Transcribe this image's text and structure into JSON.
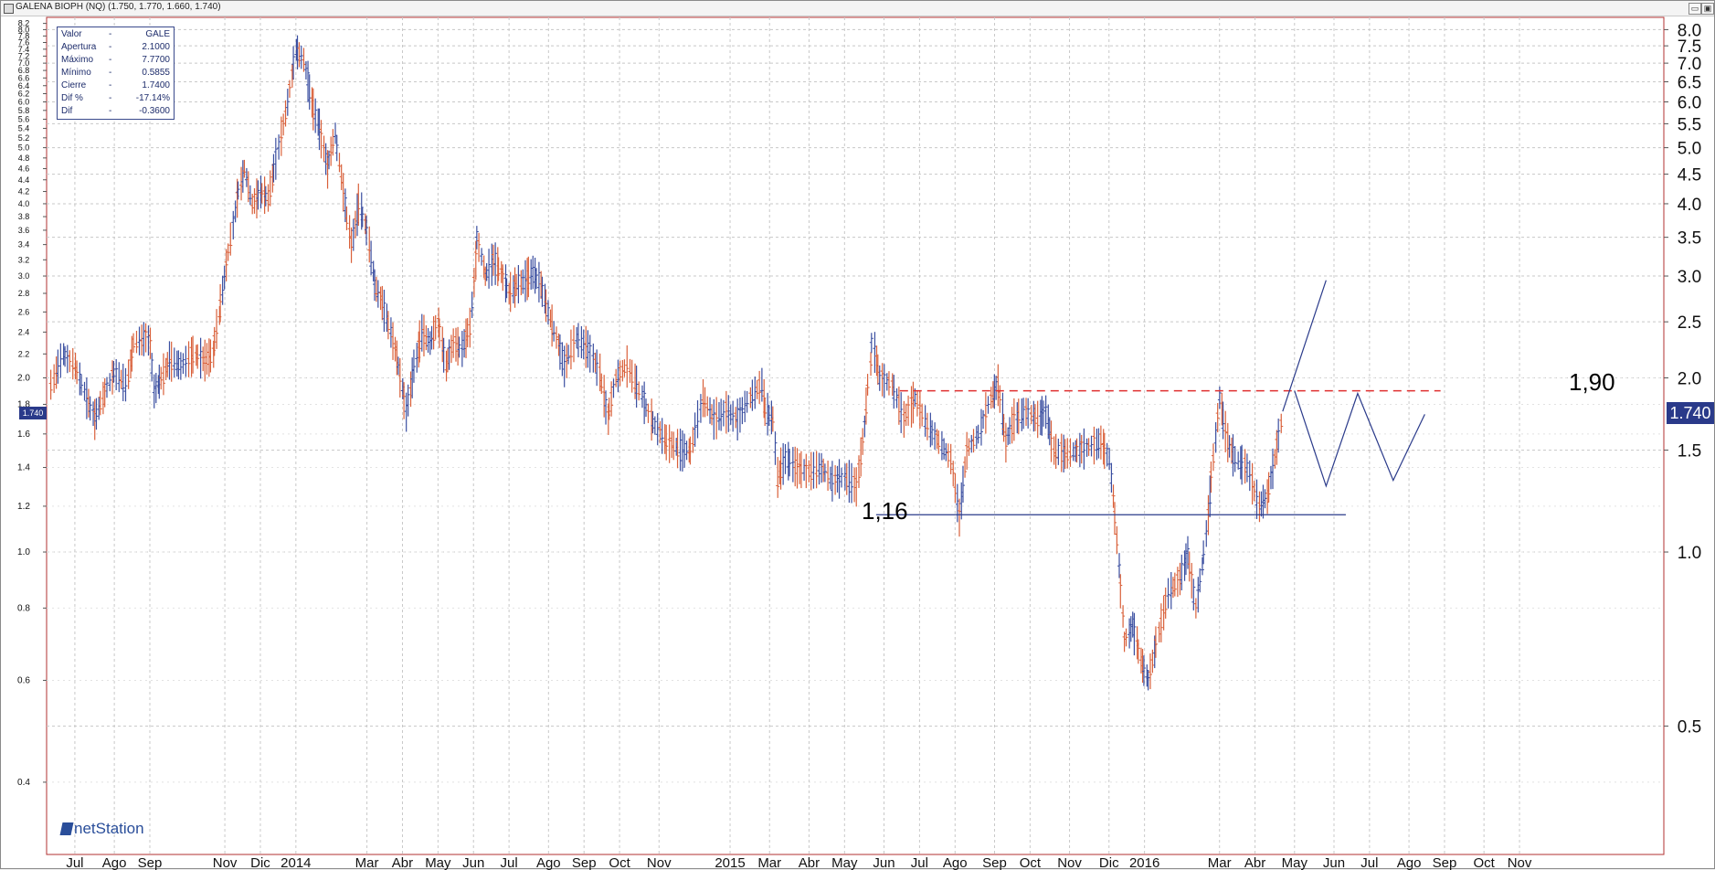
{
  "window": {
    "title": "GALENA BIOPH (NQ) (1.750, 1.770, 1.660, 1.740)",
    "buttons": [
      "▭",
      "▣"
    ]
  },
  "infobox": {
    "rows": [
      {
        "label": "Valor",
        "dash": "-",
        "value": "GALE"
      },
      {
        "label": "Apertura",
        "dash": "-",
        "value": "2.1000"
      },
      {
        "label": "Máximo",
        "dash": "-",
        "value": "7.7700"
      },
      {
        "label": "Mínimo",
        "dash": "-",
        "value": "0.5855"
      },
      {
        "label": "Cierre",
        "dash": "-",
        "value": "1.7400"
      },
      {
        "label": "Dif %",
        "dash": "-",
        "value": "-17.14%"
      },
      {
        "label": "Dif",
        "dash": "-",
        "value": "-0.3600"
      }
    ]
  },
  "logo": {
    "text": "netStation"
  },
  "annotations": {
    "resistance_label": "1,90",
    "support_label": "1,16"
  },
  "last_price": {
    "right": "1.740",
    "left": "1.740"
  },
  "colors": {
    "up_bar": "#3a4ea0",
    "down_bar": "#d9603a",
    "resistance": "#e03030",
    "support": "#2a3a8a",
    "grid": "#c8c8c8",
    "frame": "#b03030"
  },
  "chart_data": {
    "type": "ohlc",
    "title": "GALENA BIOPH (NQ)",
    "y_scale": "log",
    "ylim": [
      0.3,
      8.4
    ],
    "right_axis_ticks": [
      "8.0",
      "7.5",
      "7.0",
      "6.5",
      "6.0",
      "5.5",
      "5.0",
      "4.5",
      "4.0",
      "3.5",
      "3.0",
      "2.5",
      "2.0",
      "1.5",
      "1.0",
      "0.5"
    ],
    "left_axis_ticks": [
      "8.2",
      "8.0",
      "7.8",
      "7.6",
      "7.4",
      "7.2",
      "7.0",
      "6.8",
      "6.6",
      "6.4",
      "6.2",
      "6.0",
      "5.8",
      "5.6",
      "5.4",
      "5.2",
      "5.0",
      "4.8",
      "4.6",
      "4.4",
      "4.2",
      "4.0",
      "3.8",
      "3.6",
      "3.4",
      "3.2",
      "3.0",
      "2.8",
      "2.6",
      "2.4",
      "2.2",
      "2.0",
      "1.8",
      "1.6",
      "1.4",
      "1.2",
      "1.0",
      "0.8",
      "0.6",
      "0.4"
    ],
    "x_labels": [
      "Jul",
      "Ago",
      "Sep",
      "Nov",
      "Dic",
      "2014",
      "Mar",
      "Abr",
      "May",
      "Jun",
      "Jul",
      "Ago",
      "Sep",
      "Oct",
      "Nov",
      "2015",
      "Mar",
      "Abr",
      "May",
      "Jun",
      "Jul",
      "Ago",
      "Sep",
      "Oct",
      "Nov",
      "Dic",
      "2016",
      "Mar",
      "Abr",
      "May",
      "Jun",
      "Jul",
      "Ago",
      "Sep",
      "Oct",
      "Nov"
    ],
    "x_index_range": [
      0,
      36
    ],
    "x_label_index": [
      0.6,
      1.6,
      2.5,
      4.4,
      5.3,
      6.2,
      8.0,
      8.9,
      9.8,
      10.7,
      11.6,
      12.6,
      13.5,
      14.4,
      15.4,
      17.2,
      18.2,
      19.2,
      20.1,
      21.1,
      22.0,
      22.9,
      23.9,
      24.8,
      25.8,
      26.8,
      27.7,
      29.6,
      30.5,
      31.5,
      32.5,
      33.4,
      34.4,
      35.3,
      36.3,
      37.2
    ],
    "price_path": [
      [
        0.0,
        1.95
      ],
      [
        0.3,
        2.2
      ],
      [
        0.6,
        2.1
      ],
      [
        0.9,
        1.85
      ],
      [
        1.1,
        1.7
      ],
      [
        1.3,
        1.85
      ],
      [
        1.6,
        2.05
      ],
      [
        1.9,
        1.95
      ],
      [
        2.1,
        2.3
      ],
      [
        2.4,
        2.35
      ],
      [
        2.5,
        2.3
      ],
      [
        2.6,
        1.9
      ],
      [
        2.8,
        2.0
      ],
      [
        3.0,
        2.15
      ],
      [
        3.3,
        2.1
      ],
      [
        3.6,
        2.2
      ],
      [
        3.9,
        2.15
      ],
      [
        4.1,
        2.2
      ],
      [
        4.3,
        2.7
      ],
      [
        4.5,
        3.3
      ],
      [
        4.7,
        4.1
      ],
      [
        4.9,
        4.6
      ],
      [
        5.1,
        4.0
      ],
      [
        5.3,
        4.2
      ],
      [
        5.5,
        4.1
      ],
      [
        5.7,
        4.8
      ],
      [
        6.0,
        6.0
      ],
      [
        6.2,
        7.4
      ],
      [
        6.4,
        7.1
      ],
      [
        6.6,
        6.0
      ],
      [
        6.8,
        5.4
      ],
      [
        7.0,
        4.6
      ],
      [
        7.2,
        5.3
      ],
      [
        7.4,
        4.2
      ],
      [
        7.6,
        3.4
      ],
      [
        7.8,
        4.0
      ],
      [
        8.0,
        3.6
      ],
      [
        8.2,
        2.9
      ],
      [
        8.4,
        2.7
      ],
      [
        8.6,
        2.4
      ],
      [
        8.8,
        2.1
      ],
      [
        9.0,
        1.75
      ],
      [
        9.2,
        2.1
      ],
      [
        9.4,
        2.4
      ],
      [
        9.6,
        2.3
      ],
      [
        9.8,
        2.5
      ],
      [
        10.0,
        2.1
      ],
      [
        10.2,
        2.3
      ],
      [
        10.4,
        2.25
      ],
      [
        10.6,
        2.45
      ],
      [
        10.8,
        3.5
      ],
      [
        11.0,
        3.0
      ],
      [
        11.2,
        3.2
      ],
      [
        11.4,
        3.05
      ],
      [
        11.6,
        2.8
      ],
      [
        11.8,
        2.9
      ],
      [
        12.0,
        2.95
      ],
      [
        12.2,
        3.05
      ],
      [
        12.4,
        2.9
      ],
      [
        12.6,
        2.6
      ],
      [
        12.8,
        2.35
      ],
      [
        13.0,
        2.1
      ],
      [
        13.3,
        2.35
      ],
      [
        13.6,
        2.25
      ],
      [
        13.9,
        2.05
      ],
      [
        14.1,
        1.7
      ],
      [
        14.3,
        2.0
      ],
      [
        14.6,
        2.1
      ],
      [
        14.9,
        1.9
      ],
      [
        15.2,
        1.7
      ],
      [
        15.6,
        1.55
      ],
      [
        16.0,
        1.5
      ],
      [
        16.2,
        1.5
      ],
      [
        16.5,
        1.85
      ],
      [
        16.8,
        1.7
      ],
      [
        17.1,
        1.75
      ],
      [
        17.4,
        1.7
      ],
      [
        17.7,
        1.85
      ],
      [
        18.0,
        1.95
      ],
      [
        18.1,
        1.75
      ],
      [
        18.3,
        1.7
      ],
      [
        18.4,
        1.35
      ],
      [
        18.6,
        1.45
      ],
      [
        18.9,
        1.4
      ],
      [
        19.2,
        1.38
      ],
      [
        19.5,
        1.4
      ],
      [
        19.8,
        1.33
      ],
      [
        20.1,
        1.35
      ],
      [
        20.4,
        1.3
      ],
      [
        20.6,
        1.65
      ],
      [
        20.8,
        2.3
      ],
      [
        21.0,
        2.0
      ],
      [
        21.3,
        1.95
      ],
      [
        21.6,
        1.7
      ],
      [
        21.9,
        1.85
      ],
      [
        22.2,
        1.65
      ],
      [
        22.5,
        1.55
      ],
      [
        22.8,
        1.45
      ],
      [
        23.0,
        1.15
      ],
      [
        23.2,
        1.5
      ],
      [
        23.5,
        1.6
      ],
      [
        23.8,
        1.85
      ],
      [
        24.0,
        1.95
      ],
      [
        24.2,
        1.55
      ],
      [
        24.4,
        1.7
      ],
      [
        24.7,
        1.75
      ],
      [
        25.0,
        1.7
      ],
      [
        25.2,
        1.75
      ],
      [
        25.4,
        1.5
      ],
      [
        25.7,
        1.48
      ],
      [
        26.0,
        1.5
      ],
      [
        26.3,
        1.52
      ],
      [
        26.6,
        1.55
      ],
      [
        26.8,
        1.45
      ],
      [
        26.9,
        1.25
      ],
      [
        27.0,
        1.05
      ],
      [
        27.2,
        0.7
      ],
      [
        27.4,
        0.75
      ],
      [
        27.6,
        0.65
      ],
      [
        27.8,
        0.6
      ],
      [
        28.0,
        0.7
      ],
      [
        28.3,
        0.85
      ],
      [
        28.6,
        0.9
      ],
      [
        28.8,
        1.0
      ],
      [
        29.0,
        0.8
      ],
      [
        29.2,
        1.0
      ],
      [
        29.4,
        1.35
      ],
      [
        29.6,
        1.85
      ],
      [
        29.8,
        1.55
      ],
      [
        30.0,
        1.45
      ],
      [
        30.3,
        1.4
      ],
      [
        30.6,
        1.2
      ],
      [
        30.8,
        1.25
      ],
      [
        31.0,
        1.45
      ],
      [
        31.2,
        1.75
      ]
    ],
    "projection": [
      [
        31.2,
        1.75
      ],
      [
        32.3,
        2.95
      ]
    ],
    "projection_waves": [
      [
        31.5,
        1.9
      ],
      [
        32.3,
        1.3
      ],
      [
        33.1,
        1.88
      ],
      [
        34.0,
        1.33
      ],
      [
        34.8,
        1.73
      ]
    ],
    "resistance": {
      "value": 1.9,
      "from_index": 21.5,
      "to_index": 35.2,
      "label": "1,90"
    },
    "support": {
      "value": 1.16,
      "from_index": 20.9,
      "to_index": 32.8,
      "label": "1,16"
    },
    "last_close": 1.74
  }
}
